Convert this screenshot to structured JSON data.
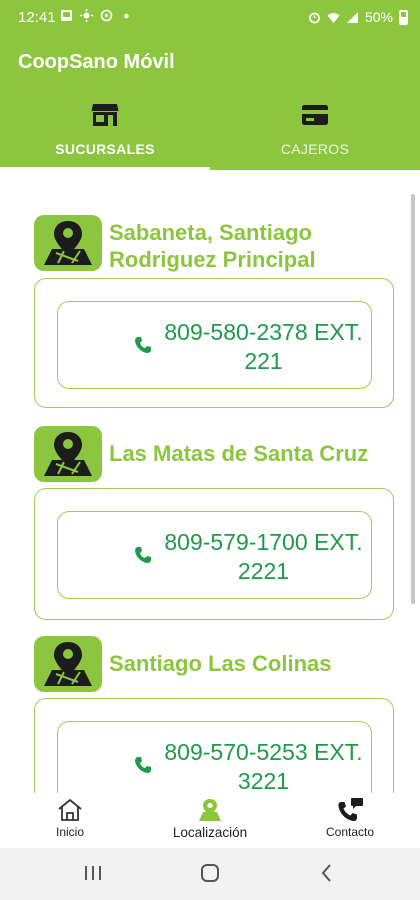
{
  "status_bar": {
    "time": "12:41",
    "battery": "50%",
    "icons": [
      "photo-icon",
      "weather-icon",
      "navigation-icon",
      "dot-icon",
      "alarm-icon",
      "wifi-icon",
      "signal-icon",
      "battery-icon"
    ]
  },
  "app": {
    "title": "CoopSano Móvil",
    "brand_color": "#8cc63f",
    "tabs": [
      {
        "label": "SUCURSALES",
        "icon": "store-icon",
        "selected": true
      },
      {
        "label": "CAJEROS",
        "icon": "card-icon",
        "selected": false
      }
    ]
  },
  "branches": [
    {
      "name": "Sabaneta, Santiago Rodriguez Principal",
      "icon": "map-pin-icon",
      "phone": "809-580-2378 EXT. 221",
      "phone_icon": "phone-icon"
    },
    {
      "name": "Las Matas de Santa Cruz",
      "icon": "map-pin-icon",
      "phone": "809-579-1700 EXT. 2221",
      "phone_icon": "phone-icon"
    },
    {
      "name": "Santiago Las Colinas",
      "icon": "map-pin-icon",
      "phone": "809-570-5253 EXT. 3221",
      "phone_icon": "phone-icon"
    }
  ],
  "bottom_nav": [
    {
      "label": "Inicio",
      "icon": "home-icon",
      "active": false
    },
    {
      "label": "Localización",
      "icon": "location-icon",
      "active": true
    },
    {
      "label": "Contacto",
      "icon": "contact-phone-icon",
      "active": false
    }
  ],
  "system_nav": [
    "recents-icon",
    "home-circle-icon",
    "back-icon"
  ]
}
